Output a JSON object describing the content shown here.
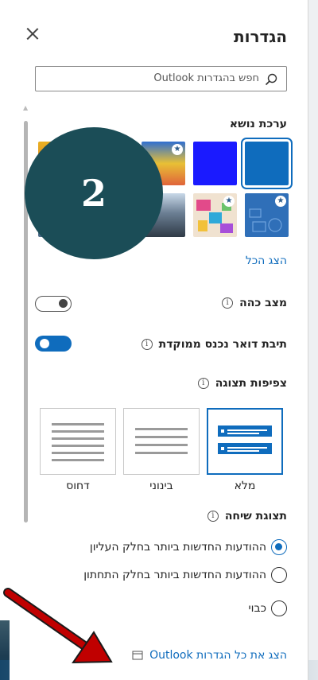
{
  "panel": {
    "title": "הגדרות",
    "search_placeholder": "חפש בהגדרות Outlook"
  },
  "theme": {
    "label": "ערכת נושא",
    "show_all": "הצג הכל"
  },
  "dark_mode": {
    "label": "מצב כהה",
    "on": false
  },
  "focused_inbox": {
    "label": "תיבת דואר נכנס ממוקדת",
    "on": true
  },
  "density": {
    "label": "צפיפות תצוגה",
    "options": [
      {
        "label": "מלא",
        "selected": true
      },
      {
        "label": "בינוני",
        "selected": false
      },
      {
        "label": "דחוס",
        "selected": false
      }
    ]
  },
  "conversation": {
    "label": "תצוגת שיחה",
    "options": [
      {
        "label": "ההודעות החדשות ביותר בחלק העליון",
        "checked": true
      },
      {
        "label": "ההודעות החדשות ביותר בחלק התחתון",
        "checked": false
      },
      {
        "label": "כבוי",
        "checked": false
      }
    ]
  },
  "footer": {
    "link": "הצג את כל הגדרות Outlook"
  },
  "overlay": {
    "badge_number": "2"
  },
  "colors": {
    "accent": "#0f6cbd",
    "badge": "#1b4d57",
    "arrow": "#c00000"
  }
}
